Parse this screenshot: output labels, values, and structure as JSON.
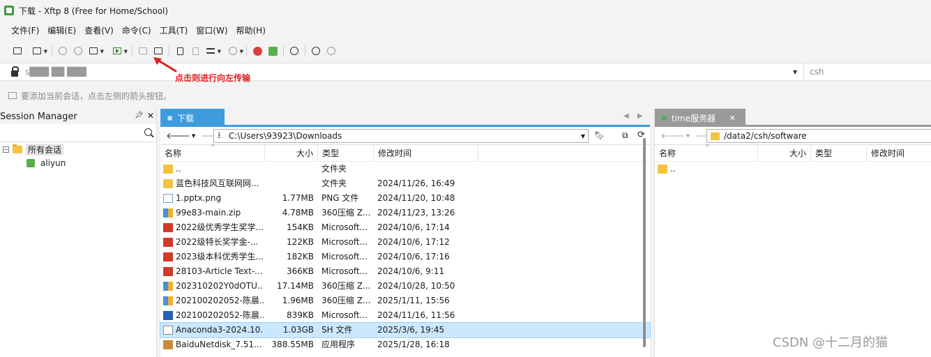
{
  "window": {
    "title": "下载 - Xftp 8 (Free for Home/School)"
  },
  "menu": [
    "文件(F)",
    "编辑(E)",
    "查看(V)",
    "命令(C)",
    "工具(T)",
    "窗口(W)",
    "帮助(H)"
  ],
  "address": {
    "host_masked": "s███ ██ ███",
    "user": "csh"
  },
  "annotation": {
    "text": "点击则进行向左传输",
    "color": "#e02020"
  },
  "hint": "要添加当前会话，点击左侧的箭头按钮。",
  "session": {
    "title": "Session Manager",
    "root": "所有会话",
    "items": [
      "aliyun"
    ]
  },
  "left": {
    "tab": "下载",
    "path": "C:\\Users\\93923\\Downloads",
    "columns": {
      "name": "名称",
      "size": "大小",
      "type": "类型",
      "mtime": "修改时间"
    },
    "rows": [
      {
        "icon": "folder",
        "name": "..",
        "size": "",
        "type": "文件夹",
        "mtime": ""
      },
      {
        "icon": "folder",
        "name": "蓝色科技风互联网网...",
        "size": "",
        "type": "文件夹",
        "mtime": "2024/11/26, 16:49"
      },
      {
        "icon": "png",
        "name": "1.pptx.png",
        "size": "1.77MB",
        "type": "PNG 文件",
        "mtime": "2024/11/20, 10:48"
      },
      {
        "icon": "zip",
        "name": "99e83-main.zip",
        "size": "4.78MB",
        "type": "360压缩 Z...",
        "mtime": "2024/11/23, 13:26"
      },
      {
        "icon": "pdf",
        "name": "2022级优秀学生奖学...",
        "size": "154KB",
        "type": "Microsoft...",
        "mtime": "2024/10/6, 17:14"
      },
      {
        "icon": "pdf",
        "name": "2022级特长奖学金-...",
        "size": "122KB",
        "type": "Microsoft...",
        "mtime": "2024/10/6, 17:12"
      },
      {
        "icon": "pdf",
        "name": "2023级本科优秀学生...",
        "size": "182KB",
        "type": "Microsoft...",
        "mtime": "2024/10/6, 17:16"
      },
      {
        "icon": "pdf",
        "name": "28103-Article Text-...",
        "size": "366KB",
        "type": "Microsoft...",
        "mtime": "2024/10/6, 9:11"
      },
      {
        "icon": "zip",
        "name": "202310202Y0dOTU...",
        "size": "17.14MB",
        "type": "360压缩 Z...",
        "mtime": "2024/10/28, 10:50"
      },
      {
        "icon": "zip",
        "name": "202100202052-陈晨...",
        "size": "1.96MB",
        "type": "360压缩 Z...",
        "mtime": "2025/1/11, 15:56"
      },
      {
        "icon": "word",
        "name": "202100202052-陈晨...",
        "size": "839KB",
        "type": "Microsoft...",
        "mtime": "2024/11/16, 11:56"
      },
      {
        "icon": "sh",
        "name": "Anaconda3-2024.10...",
        "size": "1.03GB",
        "type": "SH 文件",
        "mtime": "2025/3/6, 19:45",
        "selected": true
      },
      {
        "icon": "exe",
        "name": "BaiduNetdisk_7.51...",
        "size": "388.55MB",
        "type": "应用程序",
        "mtime": "2025/1/28, 16:18"
      }
    ]
  },
  "right": {
    "tab": "time服务器",
    "path": "/data2/csh/software",
    "columns": {
      "name": "名称",
      "size": "大小",
      "type": "类型",
      "mtime": "修改时间"
    },
    "rows": [
      {
        "icon": "folder",
        "name": ".."
      }
    ]
  },
  "watermark": "CSDN @十二月的猫",
  "colors": {
    "accent": "#3d9ddc",
    "selection": "#cce8ff",
    "connected": "#3fb34f"
  }
}
